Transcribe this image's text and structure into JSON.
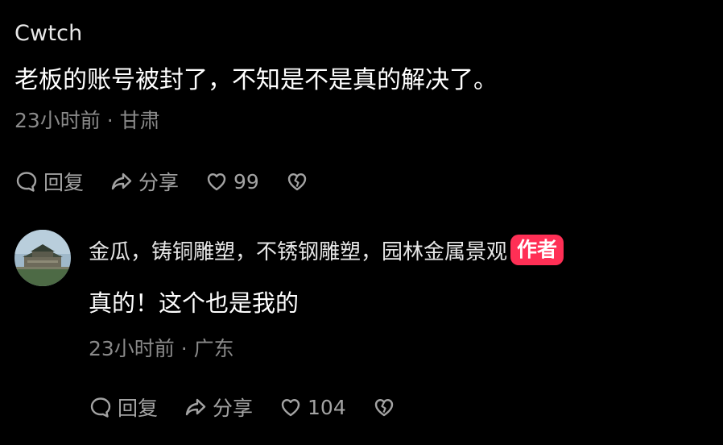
{
  "top_comment": {
    "username": "Cwtch",
    "text": "老板的账号被封了，不知是不是真的解决了。",
    "meta": "23小时前 · 甘肃",
    "actions": {
      "reply_label": "回复",
      "share_label": "分享",
      "like_count": "99"
    }
  },
  "reply": {
    "username": "金瓜，铸铜雕塑，不锈钢雕塑，园林金属景观",
    "badge": "作者",
    "text": "真的！这个也是我的",
    "meta": "23小时前 · 广东",
    "actions": {
      "reply_label": "回复",
      "share_label": "分享",
      "like_count": "104"
    }
  },
  "colors": {
    "background": "#000000",
    "primary_text": "#ffffff",
    "secondary_text": "#8a8a8a",
    "badge": "#ff2f55"
  },
  "icons": [
    "comment-bubble-icon",
    "share-arrow-icon",
    "heart-icon",
    "broken-heart-icon"
  ]
}
